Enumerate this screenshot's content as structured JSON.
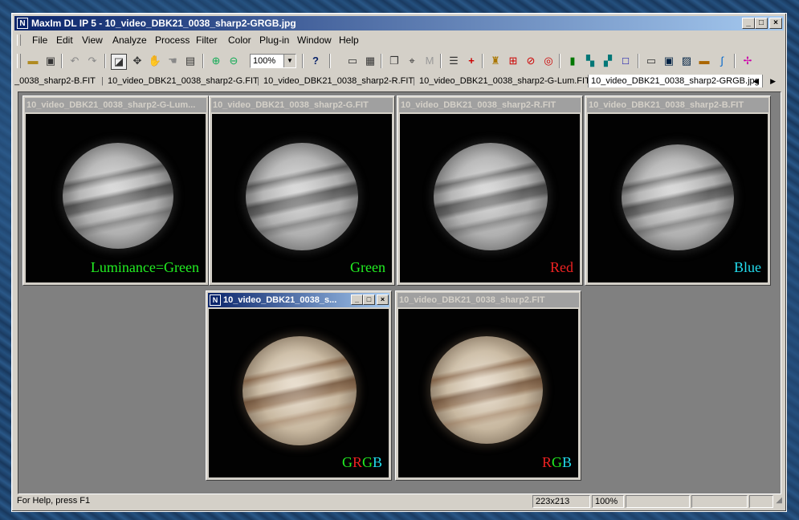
{
  "window": {
    "title": "MaxIm DL IP 5 - 10_video_DBK21_0038_sharp2-GRGB.jpg",
    "buttons": {
      "minimize": "_",
      "maximize": "□",
      "close": "×"
    }
  },
  "menu": [
    "File",
    "Edit",
    "View",
    "Analyze",
    "Process",
    "Filter",
    "Color",
    "Plug-in",
    "Window",
    "Help"
  ],
  "toolbar": {
    "zoom": "100%",
    "icons": [
      "open-icon",
      "save-icon",
      "undo-icon",
      "redo-icon",
      "select-icon",
      "move-icon",
      "hand-icon",
      "pan-icon",
      "properties-icon",
      "zoom-in-icon",
      "zoom-out-icon",
      "help-pointer-icon",
      "ruler-icon",
      "stack-icon",
      "copy-icon",
      "crosshair-icon",
      "measure-icon",
      "list-icon",
      "plus-icon",
      "bucket-icon",
      "grid-icon",
      "ring-icon",
      "fwhm-icon",
      "chart-icon",
      "align-icon",
      "combine-icon",
      "square-icon",
      "panel-icon",
      "image-icon",
      "picture-icon",
      "bar-icon",
      "curve-icon",
      "star-icon"
    ]
  },
  "tabs": [
    {
      "label": "_0038_sharp2-B.FIT",
      "active": false
    },
    {
      "label": "10_video_DBK21_0038_sharp2-G.FIT",
      "active": false
    },
    {
      "label": "10_video_DBK21_0038_sharp2-R.FIT",
      "active": false
    },
    {
      "label": "10_video_DBK21_0038_sharp2-G-Lum.FIT",
      "active": false
    },
    {
      "label": "10_video_DBK21_0038_sharp2-GRGB.jpg",
      "active": true
    }
  ],
  "tab_arrows": "◀ ▶",
  "images": [
    {
      "title": "10_video_DBK21_0038_sharp2-G-Lum...",
      "label": "Luminance=Green",
      "label_color": "#22ee22",
      "kind": "gray"
    },
    {
      "title": "10_video_DBK21_0038_sharp2-G.FIT",
      "label": "Green",
      "label_color": "#22ee22",
      "kind": "gray"
    },
    {
      "title": "10_video_DBK21_0038_sharp2-R.FIT",
      "label": "Red",
      "label_color": "#ee2222",
      "kind": "gray"
    },
    {
      "title": "10_video_DBK21_0038_sharp2-B.FIT",
      "label": "Blue",
      "label_color": "#22ddee",
      "kind": "gray"
    },
    {
      "title": "10_video_DBK21_0038_s...",
      "label_parts": [
        {
          "text": "G",
          "color": "#22ee22"
        },
        {
          "text": "R",
          "color": "#ee2222"
        },
        {
          "text": "G",
          "color": "#22ee22"
        },
        {
          "text": "B",
          "color": "#22ddee"
        }
      ],
      "kind": "color",
      "active": true
    },
    {
      "title": "10_video_DBK21_0038_sharp2.FIT",
      "label_parts": [
        {
          "text": "R",
          "color": "#ee2222"
        },
        {
          "text": "G",
          "color": "#22ee22"
        },
        {
          "text": "B",
          "color": "#22ddee"
        }
      ],
      "kind": "color"
    }
  ],
  "status": {
    "help": "For Help, press F1",
    "dimensions": "223x213",
    "zoom": "100%"
  }
}
